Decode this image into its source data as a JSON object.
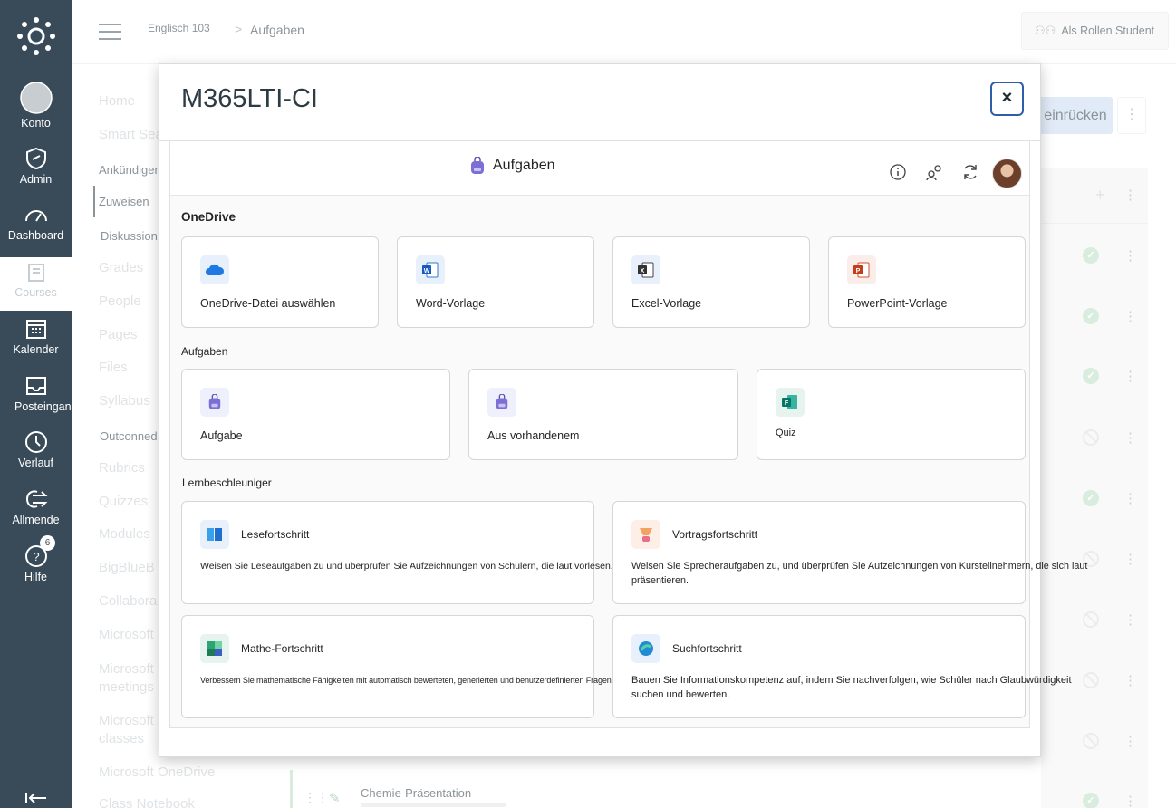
{
  "global_nav": {
    "konto": "Konto",
    "admin": "Admin",
    "dashboard": "Dashboard",
    "courses": "Courses",
    "kalender": "Kalender",
    "posteingang": "Posteingang",
    "verlauf": "Verlauf",
    "allmende": "Allmende",
    "hilfe": "Hilfe",
    "hilfe_badge": "6"
  },
  "header": {
    "course": "Englisch 103",
    "separator": ">",
    "page": "Aufgaben",
    "student_view": "Als Rollen Student"
  },
  "course_nav": {
    "items": [
      "Home",
      "Smart Sea",
      "Ankündigen",
      "Zuweisen",
      "Diskussion",
      "Grades",
      "People",
      "Pages",
      "Files",
      "Syllabus",
      "Outconned",
      "Rubrics",
      "Quizzes",
      "Modules",
      "BigBlueB",
      "Collabora",
      "Microsoft",
      "Microsoft meetings",
      "Microsoft classes",
      "Microsoft OneDrive",
      "Class Notebook"
    ]
  },
  "background": {
    "indent_button": "einrücken",
    "bottom_item": "Chemie-Präsentation"
  },
  "modal": {
    "title": "M365LTI-CI",
    "close": "×",
    "app_title": "Aufgaben",
    "sections": {
      "onedrive": "OneDrive",
      "aufgaben": "Aufgaben",
      "lern": "Lernbeschleuniger"
    },
    "onedrive_cards": [
      {
        "label": "OneDrive-Datei auswählen",
        "icon": "onedrive-icon"
      },
      {
        "label": "Word-Vorlage",
        "icon": "word-icon"
      },
      {
        "label": "Excel-Vorlage",
        "icon": "excel-icon"
      },
      {
        "label": "PowerPoint-Vorlage",
        "icon": "powerpoint-icon"
      }
    ],
    "aufgaben_cards": [
      {
        "label": "Aufgabe",
        "icon": "backpack-icon"
      },
      {
        "label": "Aus vorhandenem",
        "icon": "backpack-icon"
      },
      {
        "label": "Quiz",
        "icon": "forms-icon"
      }
    ],
    "lern_cards": [
      {
        "title": "Lesefortschritt",
        "desc": "Weisen Sie Leseaufgaben zu und überprüfen Sie Aufzeichnungen von Schülern, die laut vorlesen."
      },
      {
        "title": "Vortragsfortschritt",
        "desc": "Weisen Sie Sprecheraufgaben zu, und überprüfen Sie Aufzeichnungen von Kursteilnehmern, die sich laut präsentieren."
      },
      {
        "title": "Mathe-Fortschritt",
        "desc": "Verbessern Sie mathematische Fähigkeiten mit automatisch bewerteten, generierten und benutzerdefinierten Fragen."
      },
      {
        "title": "Suchfortschritt",
        "desc": "Bauen Sie Informationskompetenz auf, indem Sie nachverfolgen, wie Schüler nach Glaubwürdigkeit suchen und bewerten."
      }
    ]
  }
}
